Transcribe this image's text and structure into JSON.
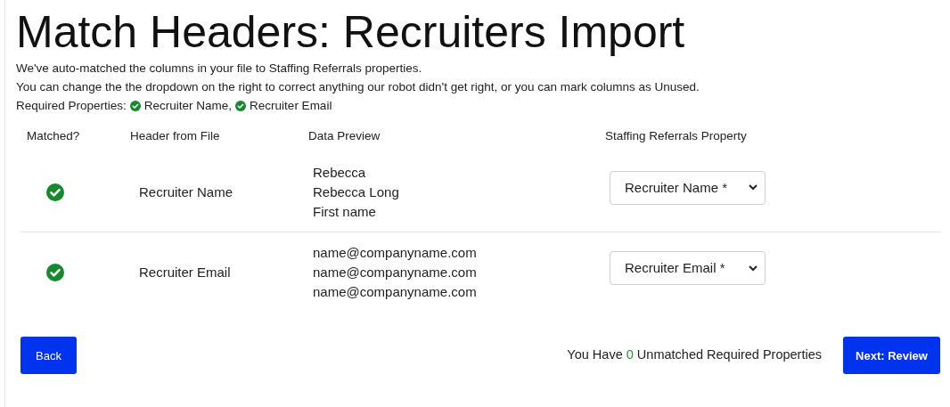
{
  "title": "Match Headers: Recruiters Import",
  "intro": [
    "We've auto-matched the columns in your file to Staffing Referrals properties.",
    "You can change the the dropdown on the right to correct anything our robot didn't get right, or you can mark columns as Unused."
  ],
  "required": {
    "label": "Required Properties:",
    "items": [
      {
        "name": "Recruiter Name,",
        "matched": true
      },
      {
        "name": "Recruiter Email",
        "matched": true
      }
    ]
  },
  "columns": [
    "Matched?",
    "Header from File",
    "Data Preview",
    "Staffing Referrals Property"
  ],
  "rows": [
    {
      "matched": true,
      "header": "Recruiter Name",
      "preview": [
        "Rebecca",
        "Rebecca Long",
        "First name"
      ],
      "property": "Recruiter Name *"
    },
    {
      "matched": true,
      "header": "Recruiter Email",
      "preview": [
        "name@companyname.com",
        "name@companyname.com",
        "name@companyname.com"
      ],
      "property": "Recruiter Email *"
    }
  ],
  "footer": {
    "back": "Back",
    "status_prefix": "You Have",
    "unmatched_count": "0",
    "status_suffix": "Unmatched Required Properties",
    "next": "Next: Review"
  }
}
